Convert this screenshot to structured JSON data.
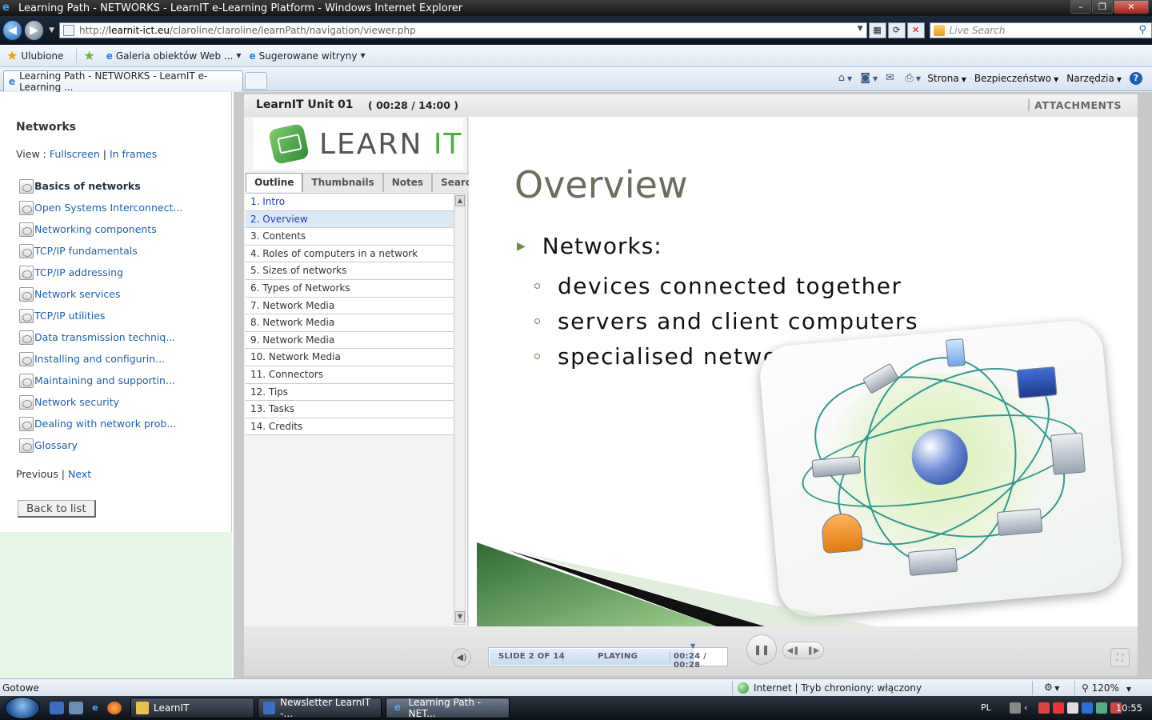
{
  "window": {
    "title": "Learning Path - NETWORKS - LearnIT e-Learning Platform - Windows Internet Explorer"
  },
  "address": {
    "url_prefix": "http://",
    "url_host": "learnit-ict.eu",
    "url_path": "/claroline/claroline/learnPath/navigation/viewer.php",
    "search_placeholder": "Live Search"
  },
  "favorites": {
    "label": "Ulubione",
    "items": [
      "Galeria obiektów Web ...",
      "Sugerowane witryny"
    ]
  },
  "tabs": {
    "active_label": "Learning Path - NETWORKS - LearnIT e-Learning ..."
  },
  "commandbar": {
    "page": "Strona",
    "safety": "Bezpieczeństwo",
    "tools": "Narzędzia",
    "help": "?"
  },
  "sidebar": {
    "title": "Networks",
    "view_label": "View : ",
    "view_fullscreen": "Fullscreen",
    "view_sep": " | ",
    "view_frames": "In frames",
    "modules": [
      "Basics of networks",
      "Open Systems Interconnect...",
      "Networking components",
      "TCP/IP fundamentals",
      "TCP/IP addressing",
      "Network services",
      "TCP/IP utilities",
      "Data transmission techniq...",
      "Installing and configurin...",
      "Maintaining and supportin...",
      "Network security",
      "Dealing with network prob...",
      "Glossary"
    ],
    "previous": "Previous",
    "nav_sep": " | ",
    "next": "Next",
    "back_button": "Back to list"
  },
  "player": {
    "unit_title": "LearnIT Unit 01",
    "time": "( 00:28 / 14:00 )",
    "attachments": "ATTACHMENTS",
    "logo_learn": "LEARN",
    "logo_it": "IT",
    "tabs": [
      "Outline",
      "Thumbnails",
      "Notes",
      "Search"
    ],
    "outline": [
      "1. Intro",
      "2. Overview",
      "3. Contents",
      "4. Roles of computers in a network",
      "5. Sizes of networks",
      "6. Types of Networks",
      "7. Network Media",
      "8. Network Media",
      "9. Network Media",
      "10. Network Media",
      "11. Connectors",
      "12. Tips",
      "13. Tasks",
      "14. Credits"
    ],
    "slide": {
      "title": "Overview",
      "main_bullet": "Networks:",
      "sub_bullets": [
        "devices connected together",
        "servers and client computers",
        "specialised network hardware"
      ]
    },
    "controls": {
      "slide_counter": "SLIDE 2 OF 14",
      "state": "PLAYING",
      "elapsed": "00:24 / 00:28",
      "progress": 0.86
    }
  },
  "status": {
    "text": "Gotowe",
    "zone": "Internet | Tryb chroniony: włączony",
    "zoom": "120%"
  },
  "taskbar": {
    "buttons": [
      "LearnIT",
      "Newsletter LearnIT -...",
      "Learning Path - NET..."
    ],
    "lang": "PL",
    "clock": "10:55"
  },
  "colors": {
    "accent_green": "#4cae3f",
    "link_blue": "#1f5fb0",
    "slide_title": "#6b6e5b"
  }
}
